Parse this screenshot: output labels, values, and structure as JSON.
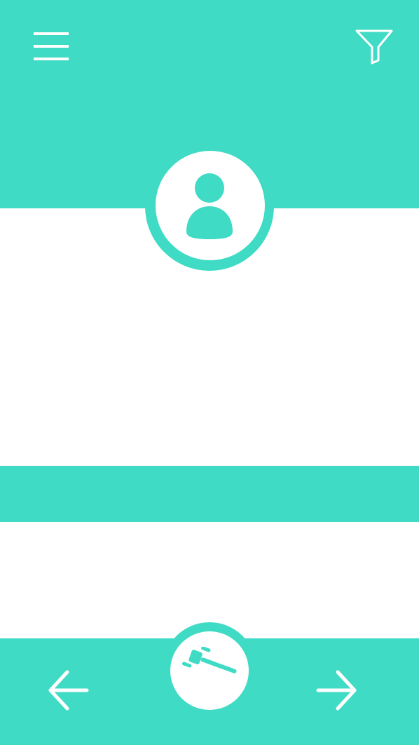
{
  "theme": {
    "accent": "#3fdbc5",
    "background": "#ffffff",
    "icon_on_accent": "#ffffff"
  },
  "header": {
    "menu_icon": "hamburger-menu-icon",
    "filter_icon": "filter-funnel-icon"
  },
  "profile": {
    "avatar_icon": "user-avatar-icon"
  },
  "bottom_nav": {
    "prev_icon": "arrow-left-icon",
    "action_icon": "gavel-icon",
    "next_icon": "arrow-right-icon"
  }
}
